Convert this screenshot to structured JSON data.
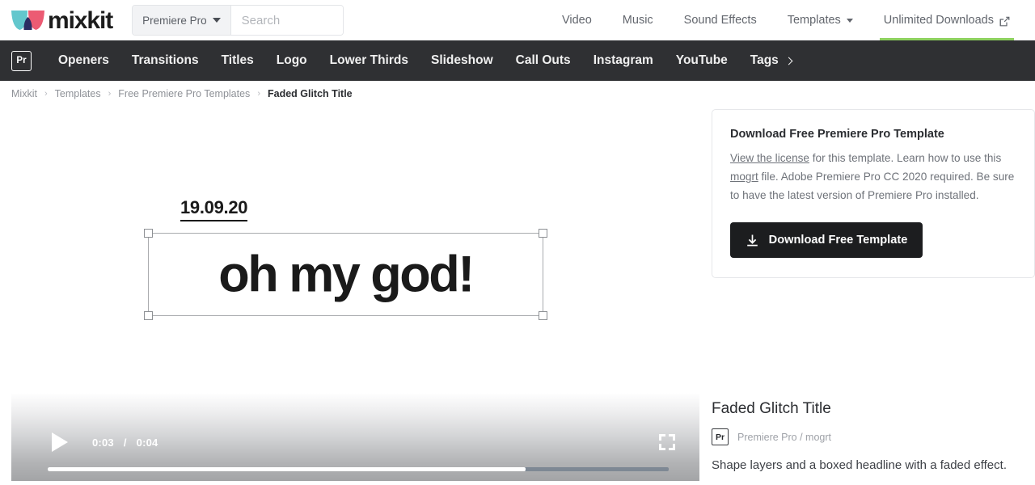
{
  "header": {
    "logo_text": "mixkit",
    "logo_colors": {
      "left_wing": "#63c7cd",
      "right_wing": "#ec5b73",
      "center": "#2b2d62"
    },
    "search": {
      "selected_category": "Premiere Pro",
      "placeholder": "Search",
      "value": "",
      "icon": "search-icon"
    },
    "nav": [
      {
        "label": "Video",
        "has_caret": false,
        "has_external": false,
        "underline": false
      },
      {
        "label": "Music",
        "has_caret": false,
        "has_external": false,
        "underline": false
      },
      {
        "label": "Sound Effects",
        "has_caret": false,
        "has_external": false,
        "underline": false
      },
      {
        "label": "Templates",
        "has_caret": true,
        "has_external": false,
        "underline": false
      },
      {
        "label": "Unlimited Downloads",
        "has_caret": false,
        "has_external": true,
        "underline": true
      }
    ],
    "underline_color": "#8ed15f"
  },
  "category_bar": {
    "badge": "Pr",
    "background": "#2f3033",
    "items": [
      {
        "label": "Openers"
      },
      {
        "label": "Transitions"
      },
      {
        "label": "Titles"
      },
      {
        "label": "Logo"
      },
      {
        "label": "Lower Thirds"
      },
      {
        "label": "Slideshow"
      },
      {
        "label": "Call Outs"
      },
      {
        "label": "Instagram"
      },
      {
        "label": "YouTube"
      },
      {
        "label": "Tags"
      }
    ],
    "more_chevron": "chevron-right-icon"
  },
  "breadcrumb": {
    "separator": "›",
    "items": [
      {
        "label": "Mixkit",
        "current": false
      },
      {
        "label": "Templates",
        "current": false
      },
      {
        "label": "Free Premiere Pro Templates",
        "current": false
      },
      {
        "label": "Faded Glitch Title",
        "current": true
      }
    ]
  },
  "preview": {
    "date_text": "19.09.20",
    "headline_text": "oh my god!",
    "selection_handles": 4
  },
  "download_card": {
    "title": "Download Free Premiere Pro Template",
    "desc_part1": "",
    "license_link": "View the license",
    "desc_part2": " for this template. Learn how to use this ",
    "mogrt_link": "mogrt",
    "desc_part3": " file. Adobe Premiere Pro CC 2020 required. Be sure to have the latest version of Premiere Pro installed.",
    "button_label": "Download Free Template",
    "button_icon": "download-icon",
    "button_color": "#1c1d1f"
  },
  "player": {
    "play_icon": "play-icon",
    "current_time": "0:03",
    "time_separator": "/",
    "total_time": "0:04",
    "fullscreen_icon": "fullscreen-icon",
    "progress_percent": 77
  },
  "detail": {
    "title": "Faded Glitch Title",
    "badge": "Pr",
    "meta": "Premiere Pro / mogrt",
    "description": "Shape layers and a boxed headline with a faded effect."
  }
}
